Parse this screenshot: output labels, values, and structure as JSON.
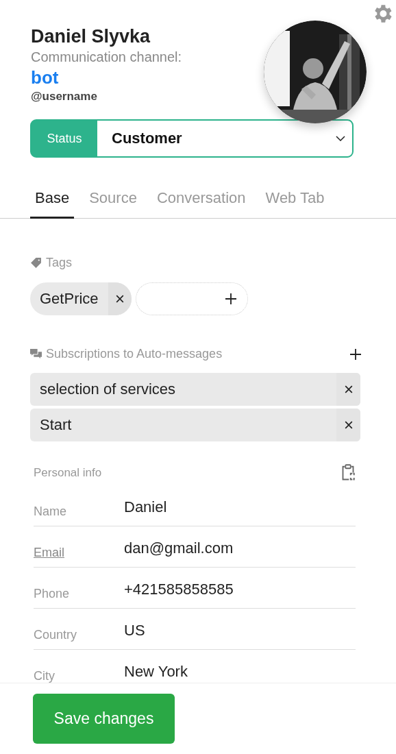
{
  "contact": {
    "name": "Daniel Slyvka",
    "channel_label": "Communication channel:",
    "channel": "bot",
    "username": "@username"
  },
  "status": {
    "label": "Status",
    "value": "Customer"
  },
  "tabs": [
    {
      "label": "Base",
      "selected": true
    },
    {
      "label": "Source",
      "selected": false
    },
    {
      "label": "Conversation",
      "selected": false
    },
    {
      "label": "Web Tab",
      "selected": false
    }
  ],
  "tags": {
    "title": "Tags",
    "items": [
      "GetPrice"
    ]
  },
  "subscriptions": {
    "title": "Subscriptions to Auto-messages",
    "items": [
      "selection of services",
      "Start"
    ]
  },
  "personal_info": {
    "title": "Personal info",
    "fields": [
      {
        "label": "Name",
        "value": "Daniel",
        "link": false
      },
      {
        "label": "Email",
        "value": "dan@gmail.com",
        "link": true
      },
      {
        "label": "Phone",
        "value": "+421585858585",
        "link": false
      },
      {
        "label": "Country",
        "value": "US",
        "link": false
      },
      {
        "label": "City",
        "value": "New York",
        "link": false
      }
    ]
  },
  "save_button": "Save changes"
}
